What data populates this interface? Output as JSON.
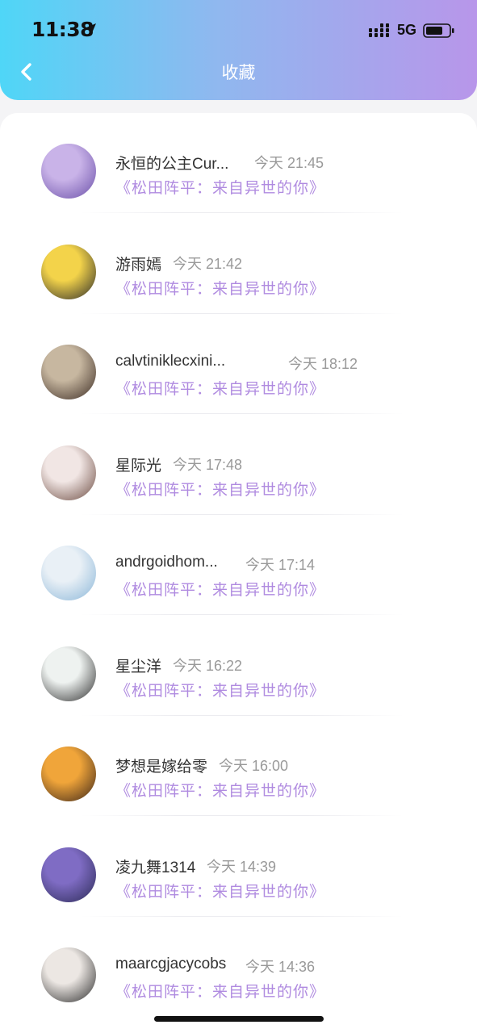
{
  "status_bar": {
    "time": "11:38",
    "network": "5G"
  },
  "header": {
    "title": "收藏"
  },
  "favorites": [
    {
      "name": "永恒的公主Cur...",
      "time": "今天 21:45",
      "work": "《松田阵平：来自异世的你》",
      "avatar_colors": [
        "#c9b3e8",
        "#6a4fa8"
      ]
    },
    {
      "name": "游雨嫣",
      "time": "今天 21:42",
      "work": "《松田阵平：来自异世的你》",
      "avatar_colors": [
        "#f3d34a",
        "#2a2a2a"
      ]
    },
    {
      "name": "calvtiniklecxini...",
      "time": "今天 18:12",
      "work": "《松田阵平：来自异世的你》",
      "avatar_colors": [
        "#c7b7a0",
        "#3a2a22"
      ]
    },
    {
      "name": "星际光",
      "time": "今天 17:48",
      "work": "《松田阵平：来自异世的你》",
      "avatar_colors": [
        "#f1e6e4",
        "#6b4a40"
      ]
    },
    {
      "name": "andrgoidhom...",
      "time": "今天 17:14",
      "work": "《松田阵平：来自异世的你》",
      "avatar_colors": [
        "#e9f0f6",
        "#8ab6d8"
      ]
    },
    {
      "name": "星尘洋",
      "time": "今天 16:22",
      "work": "《松田阵平：来自异世的你》",
      "avatar_colors": [
        "#eef2f0",
        "#2d2d2d"
      ]
    },
    {
      "name": "梦想是嫁给零",
      "time": "今天 16:00",
      "work": "《松田阵平：来自异世的你》",
      "avatar_colors": [
        "#f0a53a",
        "#3a2418"
      ]
    },
    {
      "name": "凌九舞1314",
      "time": "今天 14:39",
      "work": "《松田阵平：来自异世的你》",
      "avatar_colors": [
        "#7f6cc4",
        "#2b2a55"
      ]
    },
    {
      "name": "maarcgjacycobs",
      "time": "今天 14:36",
      "work": "《松田阵平：来自异世的你》",
      "avatar_colors": [
        "#ece7e3",
        "#2a2a2a"
      ]
    }
  ]
}
